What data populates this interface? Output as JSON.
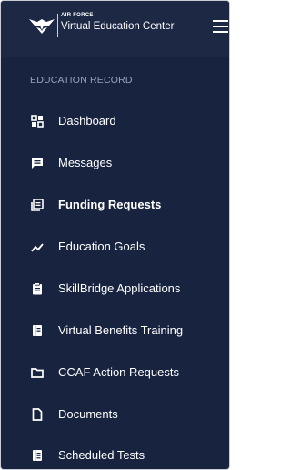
{
  "brand": {
    "org": "AIR FORCE",
    "title": "Virtual Education Center"
  },
  "sidebar": {
    "section_header": "EDUCATION RECORD",
    "items": [
      {
        "label": "Dashboard",
        "icon": "dashboard-icon",
        "active": false
      },
      {
        "label": "Messages",
        "icon": "message-icon",
        "active": false
      },
      {
        "label": "Funding Requests",
        "icon": "funding-icon",
        "active": true
      },
      {
        "label": "Education Goals",
        "icon": "trend-line-icon",
        "active": false
      },
      {
        "label": "SkillBridge Applications",
        "icon": "clipboard-icon",
        "active": false
      },
      {
        "label": "Virtual Benefits Training",
        "icon": "book-icon",
        "active": false
      },
      {
        "label": "CCAF Action Requests",
        "icon": "folder-icon",
        "active": false
      },
      {
        "label": "Documents",
        "icon": "document-icon",
        "active": false
      },
      {
        "label": "Scheduled Tests",
        "icon": "calendar-list-icon",
        "active": false
      }
    ]
  },
  "colors": {
    "sidebar_bg": "#17233f",
    "header_bg": "#1c2844",
    "text": "#ffffff",
    "muted_text": "#97a2bb"
  }
}
